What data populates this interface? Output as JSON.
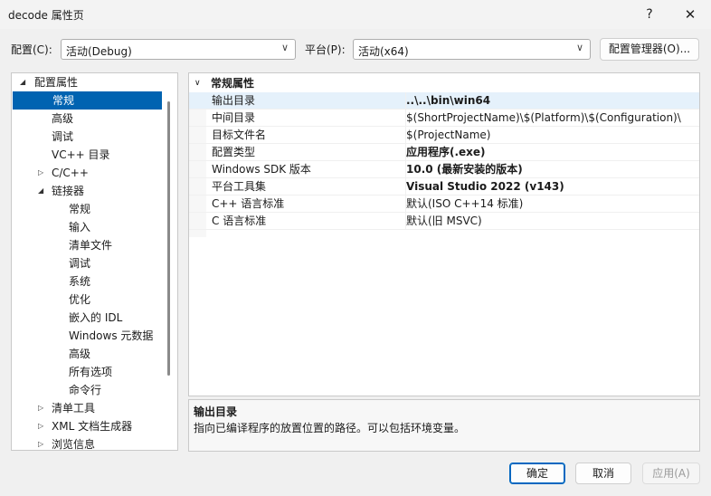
{
  "window": {
    "title": "decode 属性页",
    "help_label": "?",
    "close_label": "✕"
  },
  "toolbar": {
    "config_label": "配置(C):",
    "config_value": "活动(Debug)",
    "platform_label": "平台(P):",
    "platform_value": "活动(x64)",
    "config_manager_label": "配置管理器(O)..."
  },
  "tree": {
    "items": [
      {
        "label": "配置属性",
        "level": 0,
        "expander": "◢"
      },
      {
        "label": "常规",
        "level": 1,
        "expander": "",
        "selected": true
      },
      {
        "label": "高级",
        "level": 1,
        "expander": ""
      },
      {
        "label": "调试",
        "level": 1,
        "expander": ""
      },
      {
        "label": "VC++ 目录",
        "level": 1,
        "expander": ""
      },
      {
        "label": "C/C++",
        "level": 1,
        "expander": "▷"
      },
      {
        "label": "链接器",
        "level": 1,
        "expander": "◢"
      },
      {
        "label": "常规",
        "level": 2,
        "expander": ""
      },
      {
        "label": "输入",
        "level": 2,
        "expander": ""
      },
      {
        "label": "清单文件",
        "level": 2,
        "expander": ""
      },
      {
        "label": "调试",
        "level": 2,
        "expander": ""
      },
      {
        "label": "系统",
        "level": 2,
        "expander": ""
      },
      {
        "label": "优化",
        "level": 2,
        "expander": ""
      },
      {
        "label": "嵌入的 IDL",
        "level": 2,
        "expander": ""
      },
      {
        "label": "Windows 元数据",
        "level": 2,
        "expander": ""
      },
      {
        "label": "高级",
        "level": 2,
        "expander": ""
      },
      {
        "label": "所有选项",
        "level": 2,
        "expander": ""
      },
      {
        "label": "命令行",
        "level": 2,
        "expander": ""
      },
      {
        "label": "清单工具",
        "level": 1,
        "expander": "▷"
      },
      {
        "label": "XML 文档生成器",
        "level": 1,
        "expander": "▷"
      },
      {
        "label": "浏览信息",
        "level": 1,
        "expander": "▷"
      }
    ]
  },
  "grid": {
    "category": "常规属性",
    "category_expander": "∨",
    "rows": [
      {
        "name": "输出目录",
        "value": "..\\..\\bin\\win64",
        "bold": true,
        "selected": true
      },
      {
        "name": "中间目录",
        "value": "$(ShortProjectName)\\$(Platform)\\$(Configuration)\\",
        "bold": false
      },
      {
        "name": "目标文件名",
        "value": "$(ProjectName)",
        "bold": false
      },
      {
        "name": "配置类型",
        "value": "应用程序(.exe)",
        "bold": true
      },
      {
        "name": "Windows SDK 版本",
        "value": "10.0 (最新安装的版本)",
        "bold": true
      },
      {
        "name": "平台工具集",
        "value": "Visual Studio 2022 (v143)",
        "bold": true
      },
      {
        "name": "C++ 语言标准",
        "value": "默认(ISO C++14 标准)",
        "bold": false
      },
      {
        "name": "C 语言标准",
        "value": "默认(旧 MSVC)",
        "bold": false
      }
    ]
  },
  "description": {
    "title": "输出目录",
    "text": "指向已编译程序的放置位置的路径。可以包括环境变量。"
  },
  "buttons": {
    "ok": "确定",
    "cancel": "取消",
    "apply": "应用(A)"
  }
}
